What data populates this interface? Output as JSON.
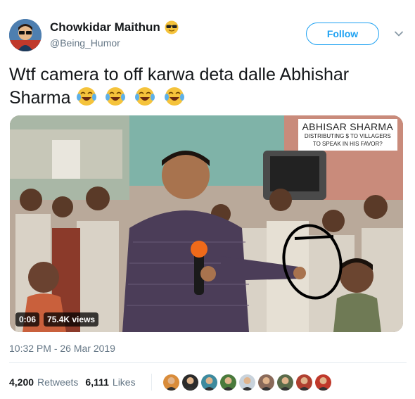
{
  "author": {
    "display_name": "Chowkidar Maithun",
    "handle": "@Being_Humor",
    "name_emoji_icon": "sunglasses-face-emoji"
  },
  "follow_button": {
    "label": "Follow"
  },
  "menu_caret_icon": "chevron-down-icon",
  "tweet": {
    "text": "Wtf camera to off karwa deta dalle Abhishar Sharma",
    "trailing_emoji": [
      "face-with-tears-of-joy",
      "face-with-tears-of-joy",
      "face-with-tears-of-joy",
      "face-with-tears-of-joy"
    ]
  },
  "media": {
    "overlay_title": "ABHISAR SHARMA",
    "overlay_subtitle_line1": "DISTRIBUTING $ TO VILLAGERS",
    "overlay_subtitle_line2": "TO SPEAK IN HIS FAVOR?",
    "duration": "0:06",
    "views": "75.4K views"
  },
  "timestamp": "10:32 PM - 26 Mar 2019",
  "stats": {
    "retweets_count": "4,200",
    "retweets_label": "Retweets",
    "likes_count": "6,111",
    "likes_label": "Likes"
  },
  "likers": [
    {
      "color": "#d98c3a"
    },
    {
      "color": "#2b2b2b"
    },
    {
      "color": "#3d8a9e"
    },
    {
      "color": "#4a7a3c"
    },
    {
      "color": "#c9d3dc"
    },
    {
      "color": "#8a6a5a"
    },
    {
      "color": "#5a6b4a"
    },
    {
      "color": "#b04030"
    },
    {
      "color": "#c0392b"
    }
  ],
  "colors": {
    "accent": "#1da1f2",
    "secondary_text": "#657786",
    "primary_text": "#14171a",
    "divider": "#e6ecf0"
  }
}
